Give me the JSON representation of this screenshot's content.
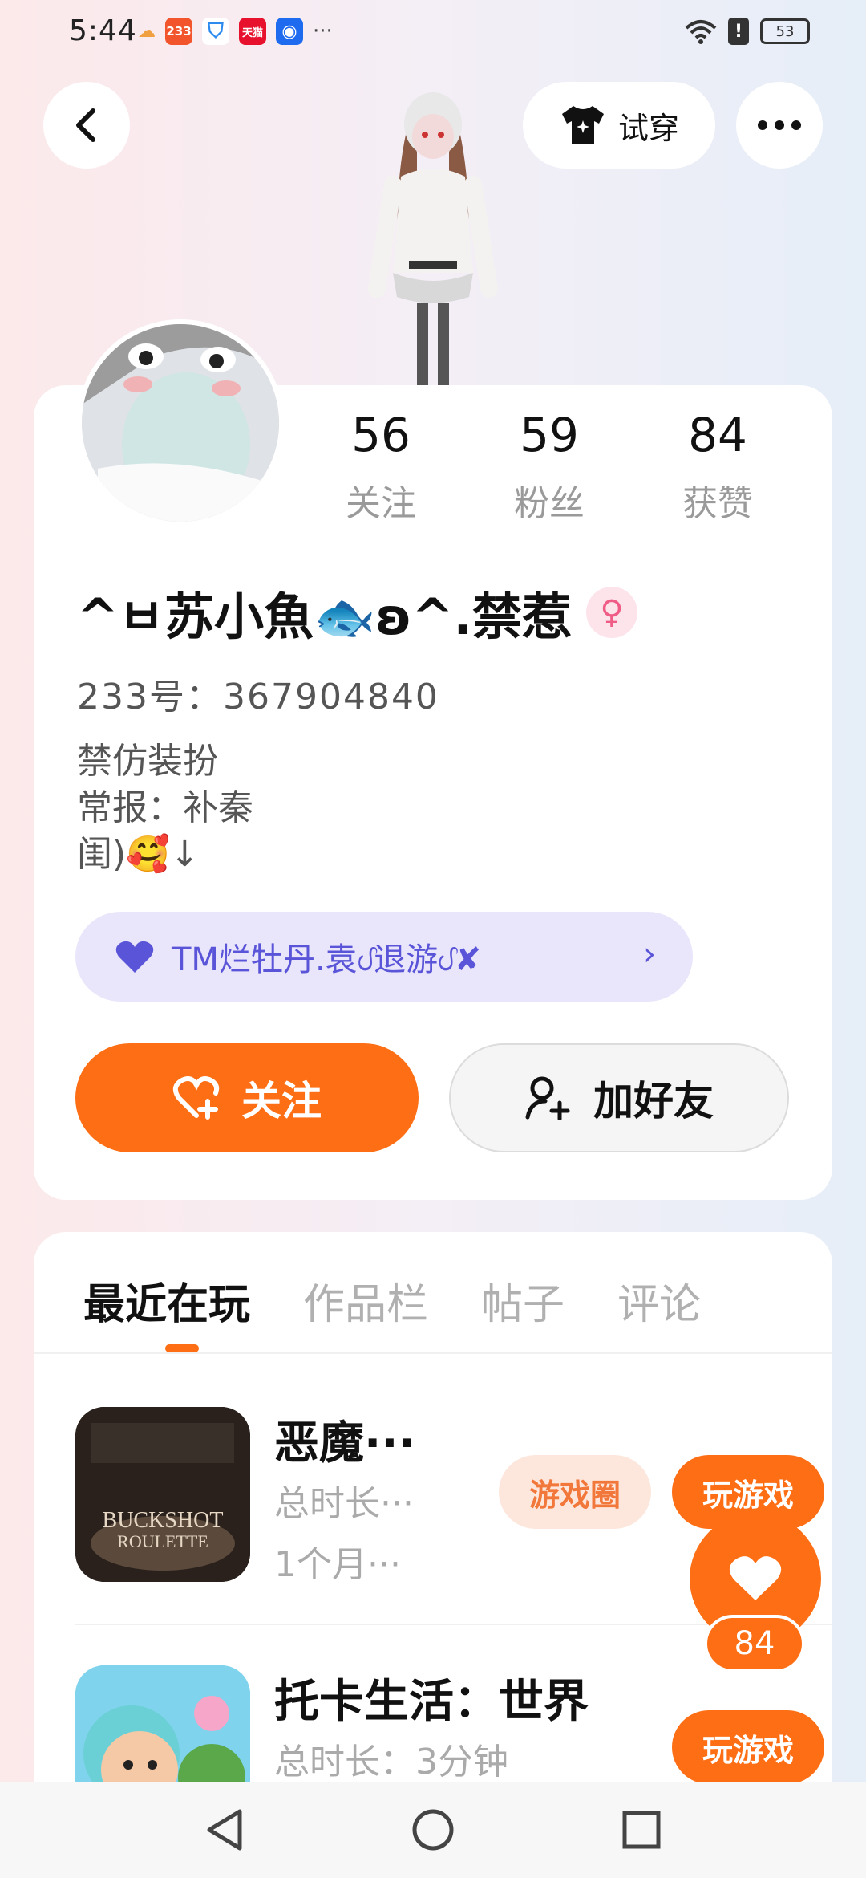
{
  "status_bar": {
    "time": "5:44",
    "app_badge": "233",
    "battery": "53"
  },
  "header": {
    "tryon_label": "试穿"
  },
  "profile": {
    "stats": [
      {
        "value": "56",
        "label": "关注"
      },
      {
        "value": "59",
        "label": "粉丝"
      },
      {
        "value": "84",
        "label": "获赞"
      }
    ],
    "username": "^ㅂ苏小魚🐟ʚ^.禁惹",
    "gender_symbol": "♀",
    "user_id": "233号：367904840",
    "bio": [
      "禁仿装扮",
      "常报：补秦",
      "闺)🥰↓"
    ],
    "guild": "TM烂牡丹.袁ᦔ退游ᦔ✘",
    "follow_label": "关注",
    "add_friend_label": "加好友"
  },
  "tabs": [
    "最近在玩",
    "作品栏",
    "帖子",
    "评论"
  ],
  "games": [
    {
      "title": "恶魔···",
      "duration": "总时长···",
      "last_played": "1个月···",
      "circle_label": "游戏圈",
      "play_label": "玩游戏",
      "icon_text": "BUCKSHOT ROULETTE"
    },
    {
      "title": "托卡生活：世界",
      "duration": "总时长：3分钟",
      "play_label": "玩游戏"
    }
  ],
  "like_count": "84",
  "colors": {
    "accent": "#fe6e14",
    "guild_bg": "#e9e6fb",
    "guild_text": "#5a55d8",
    "gender_pink": "#ef5c86"
  }
}
